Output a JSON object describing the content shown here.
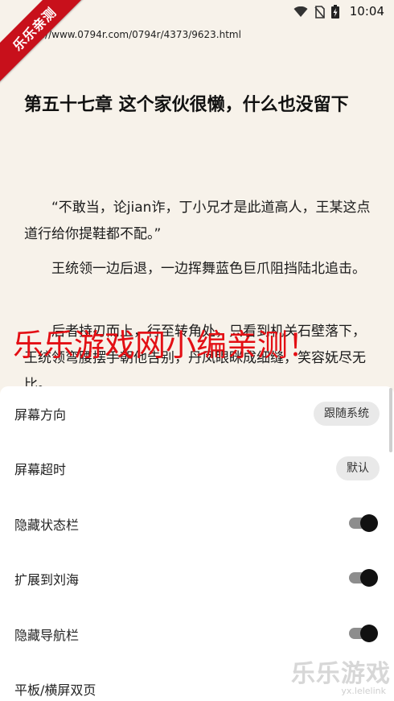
{
  "status_bar": {
    "time": "10:04",
    "icons": [
      "wifi-icon",
      "no-sim-icon",
      "battery-charging-icon"
    ]
  },
  "ribbon": {
    "text": "乐乐亲测"
  },
  "reader": {
    "url": "://www.0794r.com/0794r/4373/9623.html",
    "chapter_title": "第五十七章 这个家伙很懒，什么也没留下",
    "paragraphs": [
      "“不敢当，论jian诈，丁小兄才是此道高人，王某这点道行给你提鞋都不配。”",
      "王统领一边后退，一边挥舞蓝色巨爪阻挡陆北追击。",
      "后者持刃而上，行至转角处，只看到机关石壁落下，王统领弯腰摆手朝他告别，丹凤眼眯成细缝，笑容妩尽无比。"
    ],
    "watermark": "乐乐游戏网小编亲测！"
  },
  "settings": {
    "rows": [
      {
        "label": "屏幕方向",
        "control": "chip",
        "value": "跟随系统"
      },
      {
        "label": "屏幕超时",
        "control": "chip",
        "value": "默认"
      },
      {
        "label": "隐藏状态栏",
        "control": "toggle",
        "on": true
      },
      {
        "label": "扩展到刘海",
        "control": "toggle",
        "on": true
      },
      {
        "label": "隐藏导航栏",
        "control": "toggle",
        "on": true
      },
      {
        "label": "平板/横屏双页",
        "control": "none"
      }
    ]
  },
  "corner_logo": {
    "title": "乐乐游戏",
    "subtitle": "yx.lelelink"
  },
  "colors": {
    "reader_bg": "#f7f2ea",
    "ribbon": "#c8101b",
    "watermark": "#e30f14",
    "toggle_on": "#111111"
  }
}
